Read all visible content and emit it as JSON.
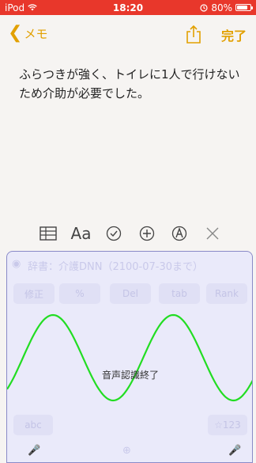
{
  "status_bar": {
    "carrier": "iPod",
    "time": "18:20",
    "battery_text": "80%",
    "battery_level": 0.8,
    "wifi_icon": "wifi-icon",
    "battery_icon": "battery-icon",
    "alarm_icon": "alarm-icon"
  },
  "nav": {
    "back_label": "メモ",
    "done_label": "完了",
    "share_icon": "share-icon",
    "back_icon": "chevron-left-icon"
  },
  "note": {
    "text": "ふらつきが強く、トイレに1人で行けないため介助が必要でした。"
  },
  "toolbar": {
    "items": [
      {
        "name": "table-icon"
      },
      {
        "name": "format-text-icon",
        "label": "Aa"
      },
      {
        "name": "checklist-icon"
      },
      {
        "name": "add-icon"
      },
      {
        "name": "markup-icon"
      },
      {
        "name": "close-icon"
      }
    ]
  },
  "voice_panel": {
    "status": "音声認識終了",
    "ghost_dictionary": "辞書：介護DNN（2100-07-30まで）",
    "ghost_keys": [
      "修正",
      "%",
      "Del",
      "tab",
      "Rank"
    ],
    "ghost_bottom": [
      "abc",
      "☆123"
    ],
    "wave_color": "#22dd22"
  },
  "colors": {
    "accent": "#e2a000",
    "status_bar": "#e8372b",
    "panel_bg": "#eaeafa"
  }
}
